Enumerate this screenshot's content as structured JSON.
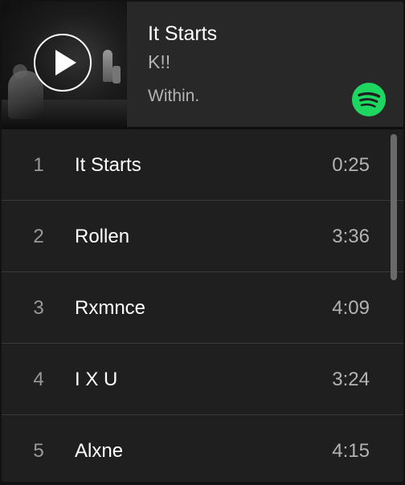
{
  "now_playing": {
    "title": "It Starts",
    "artist": "K!!",
    "album": "Within."
  },
  "icons": {
    "play": "play-icon",
    "brand": "spotify-logo"
  },
  "colors": {
    "brand": "#1ed760",
    "background": "#282828",
    "list_background": "#1f1f1f",
    "secondary_text": "#b3b3b3"
  },
  "tracks": [
    {
      "number": "1",
      "name": "It Starts",
      "duration": "0:25"
    },
    {
      "number": "2",
      "name": "Rollen",
      "duration": "3:36"
    },
    {
      "number": "3",
      "name": "Rxmnce",
      "duration": "4:09"
    },
    {
      "number": "4",
      "name": "I X U",
      "duration": "3:24"
    },
    {
      "number": "5",
      "name": "Alxne",
      "duration": "4:15"
    }
  ]
}
